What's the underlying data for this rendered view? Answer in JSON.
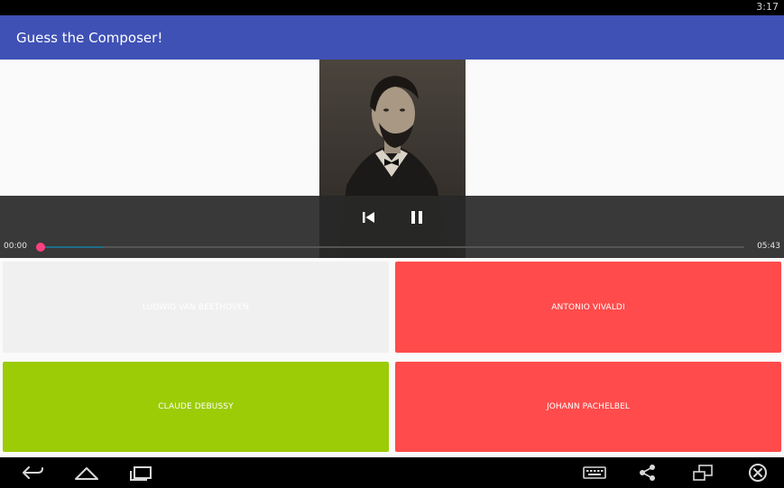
{
  "status_bar": {
    "time": "3:17"
  },
  "app_bar": {
    "title": "Guess the Composer!",
    "color": "#3f51b5"
  },
  "player": {
    "current_time": "00:00",
    "total_time": "05:43",
    "progress_fraction": 0.0,
    "buffered_fraction": 0.09,
    "thumb_color": "#ff4081",
    "portrait_icon": "composer-portrait"
  },
  "answers": [
    {
      "label": "LUDWIG VAN BEETHOVEN",
      "color": "#f0f0f0"
    },
    {
      "label": "ANTONIO VIVALDI",
      "color": "#ff4b4b"
    },
    {
      "label": "CLAUDE DEBUSSY",
      "color": "#9ccc06"
    },
    {
      "label": "JOHANN PACHELBEL",
      "color": "#ff4b4b"
    }
  ],
  "nav_bar": {
    "icons": [
      "back-icon",
      "home-icon",
      "recents-icon",
      "keyboard-icon",
      "share-icon",
      "screen-rotate-icon",
      "close-icon"
    ]
  }
}
